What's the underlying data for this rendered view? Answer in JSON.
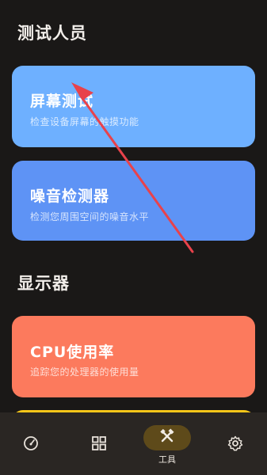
{
  "sections": {
    "testers": "测试人员",
    "display": "显示器"
  },
  "cards": {
    "screen_test": {
      "title": "屏幕测试",
      "desc": "检查设备屏幕的触摸功能"
    },
    "noise_meter": {
      "title": "噪音检测器",
      "desc": "检测您周围空间的噪音水平"
    },
    "cpu_usage": {
      "title": "CPU使用率",
      "desc": "追踪您的处理器的使用量"
    }
  },
  "nav": {
    "items": [
      {
        "icon": "speedometer-icon"
      },
      {
        "icon": "grid-icon"
      },
      {
        "icon": "tools-icon",
        "label": "工具",
        "active": true
      },
      {
        "icon": "gear-icon"
      }
    ]
  },
  "colors": {
    "background": "#1a1817",
    "card_screen": "#6eb0ff",
    "card_noise": "#5e93f5",
    "card_cpu": "#fc7a5d",
    "card_yellow": "#f8c619",
    "nav_bg": "#2a2623",
    "nav_active": "#5e4a1a",
    "arrow": "#e8424b"
  }
}
